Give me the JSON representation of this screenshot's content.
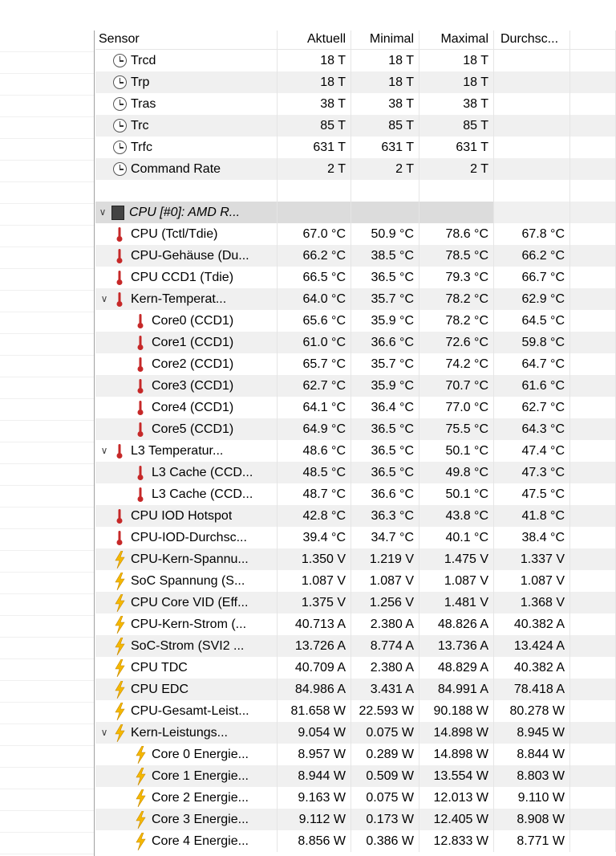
{
  "columns": {
    "sensor": "Sensor",
    "current": "Aktuell",
    "min": "Minimal",
    "max": "Maximal",
    "avg": "Durchsc..."
  },
  "rows": [
    {
      "indent": 1,
      "icon": "clock-icon",
      "label": "Trcd",
      "cur": "18 T",
      "min": "18 T",
      "max": "18 T",
      "avg": ""
    },
    {
      "indent": 1,
      "icon": "clock-icon",
      "label": "Trp",
      "cur": "18 T",
      "min": "18 T",
      "max": "18 T",
      "avg": ""
    },
    {
      "indent": 1,
      "icon": "clock-icon",
      "label": "Tras",
      "cur": "38 T",
      "min": "38 T",
      "max": "38 T",
      "avg": ""
    },
    {
      "indent": 1,
      "icon": "clock-icon",
      "label": "Trc",
      "cur": "85 T",
      "min": "85 T",
      "max": "85 T",
      "avg": ""
    },
    {
      "indent": 1,
      "icon": "clock-icon",
      "label": "Trfc",
      "cur": "631 T",
      "min": "631 T",
      "max": "631 T",
      "avg": ""
    },
    {
      "indent": 1,
      "icon": "clock-icon",
      "label": "Command Rate",
      "cur": "2 T",
      "min": "2 T",
      "max": "2 T",
      "avg": ""
    },
    {
      "indent": 0,
      "icon": "",
      "label": "",
      "cur": "",
      "min": "",
      "max": "",
      "avg": ""
    },
    {
      "indent": 0,
      "icon": "chip-icon",
      "chevron": true,
      "group": true,
      "italic": true,
      "label": "CPU [#0]: AMD R...",
      "cur": "",
      "min": "",
      "max": "",
      "avg": ""
    },
    {
      "indent": 1,
      "icon": "thermometer-icon",
      "label": "CPU (Tctl/Tdie)",
      "cur": "67.0 °C",
      "min": "50.9 °C",
      "max": "78.6 °C",
      "avg": "67.8 °C"
    },
    {
      "indent": 1,
      "icon": "thermometer-icon",
      "label": "CPU-Gehäuse (Du...",
      "cur": "66.2 °C",
      "min": "38.5 °C",
      "max": "78.5 °C",
      "avg": "66.2 °C"
    },
    {
      "indent": 1,
      "icon": "thermometer-icon",
      "label": "CPU CCD1 (Tdie)",
      "cur": "66.5 °C",
      "min": "36.5 °C",
      "max": "79.3 °C",
      "avg": "66.7 °C"
    },
    {
      "indent": 1,
      "icon": "thermometer-icon",
      "chevron": true,
      "label": "Kern-Temperat...",
      "cur": "64.0 °C",
      "min": "35.7 °C",
      "max": "78.2 °C",
      "avg": "62.9 °C"
    },
    {
      "indent": 2,
      "icon": "thermometer-icon",
      "label": "Core0 (CCD1)",
      "cur": "65.6 °C",
      "min": "35.9 °C",
      "max": "78.2 °C",
      "avg": "64.5 °C"
    },
    {
      "indent": 2,
      "icon": "thermometer-icon",
      "label": "Core1 (CCD1)",
      "cur": "61.0 °C",
      "min": "36.6 °C",
      "max": "72.6 °C",
      "avg": "59.8 °C"
    },
    {
      "indent": 2,
      "icon": "thermometer-icon",
      "label": "Core2 (CCD1)",
      "cur": "65.7 °C",
      "min": "35.7 °C",
      "max": "74.2 °C",
      "avg": "64.7 °C"
    },
    {
      "indent": 2,
      "icon": "thermometer-icon",
      "label": "Core3 (CCD1)",
      "cur": "62.7 °C",
      "min": "35.9 °C",
      "max": "70.7 °C",
      "avg": "61.6 °C"
    },
    {
      "indent": 2,
      "icon": "thermometer-icon",
      "label": "Core4 (CCD1)",
      "cur": "64.1 °C",
      "min": "36.4 °C",
      "max": "77.0 °C",
      "avg": "62.7 °C"
    },
    {
      "indent": 2,
      "icon": "thermometer-icon",
      "label": "Core5 (CCD1)",
      "cur": "64.9 °C",
      "min": "36.5 °C",
      "max": "75.5 °C",
      "avg": "64.3 °C"
    },
    {
      "indent": 1,
      "icon": "thermometer-icon",
      "chevron": true,
      "label": "L3 Temperatur...",
      "cur": "48.6 °C",
      "min": "36.5 °C",
      "max": "50.1 °C",
      "avg": "47.4 °C"
    },
    {
      "indent": 2,
      "icon": "thermometer-icon",
      "label": "L3 Cache (CCD...",
      "cur": "48.5 °C",
      "min": "36.5 °C",
      "max": "49.8 °C",
      "avg": "47.3 °C"
    },
    {
      "indent": 2,
      "icon": "thermometer-icon",
      "label": "L3 Cache (CCD...",
      "cur": "48.7 °C",
      "min": "36.6 °C",
      "max": "50.1 °C",
      "avg": "47.5 °C"
    },
    {
      "indent": 1,
      "icon": "thermometer-icon",
      "label": "CPU IOD Hotspot",
      "cur": "42.8 °C",
      "min": "36.3 °C",
      "max": "43.8 °C",
      "avg": "41.8 °C"
    },
    {
      "indent": 1,
      "icon": "thermometer-icon",
      "label": "CPU-IOD-Durchsc...",
      "cur": "39.4 °C",
      "min": "34.7 °C",
      "max": "40.1 °C",
      "avg": "38.4 °C"
    },
    {
      "indent": 1,
      "icon": "lightning-icon",
      "label": "CPU-Kern-Spannu...",
      "cur": "1.350 V",
      "min": "1.219 V",
      "max": "1.475 V",
      "avg": "1.337 V"
    },
    {
      "indent": 1,
      "icon": "lightning-icon",
      "label": "SoC Spannung (S...",
      "cur": "1.087 V",
      "min": "1.087 V",
      "max": "1.087 V",
      "avg": "1.087 V"
    },
    {
      "indent": 1,
      "icon": "lightning-icon",
      "label": "CPU Core VID (Eff...",
      "cur": "1.375 V",
      "min": "1.256 V",
      "max": "1.481 V",
      "avg": "1.368 V"
    },
    {
      "indent": 1,
      "icon": "lightning-icon",
      "label": "CPU-Kern-Strom (...",
      "cur": "40.713 A",
      "min": "2.380 A",
      "max": "48.826 A",
      "avg": "40.382 A"
    },
    {
      "indent": 1,
      "icon": "lightning-icon",
      "label": "SoC-Strom (SVI2 ...",
      "cur": "13.726 A",
      "min": "8.774 A",
      "max": "13.736 A",
      "avg": "13.424 A"
    },
    {
      "indent": 1,
      "icon": "lightning-icon",
      "label": "CPU TDC",
      "cur": "40.709 A",
      "min": "2.380 A",
      "max": "48.829 A",
      "avg": "40.382 A"
    },
    {
      "indent": 1,
      "icon": "lightning-icon",
      "label": "CPU EDC",
      "cur": "84.986 A",
      "min": "3.431 A",
      "max": "84.991 A",
      "avg": "78.418 A"
    },
    {
      "indent": 1,
      "icon": "lightning-icon",
      "label": "CPU-Gesamt-Leist...",
      "cur": "81.658 W",
      "min": "22.593 W",
      "max": "90.188 W",
      "avg": "80.278 W"
    },
    {
      "indent": 1,
      "icon": "lightning-icon",
      "chevron": true,
      "label": "Kern-Leistungs...",
      "cur": "9.054 W",
      "min": "0.075 W",
      "max": "14.898 W",
      "avg": "8.945 W"
    },
    {
      "indent": 2,
      "icon": "lightning-icon",
      "label": "Core 0 Energie...",
      "cur": "8.957 W",
      "min": "0.289 W",
      "max": "14.898 W",
      "avg": "8.844 W"
    },
    {
      "indent": 2,
      "icon": "lightning-icon",
      "label": "Core 1 Energie...",
      "cur": "8.944 W",
      "min": "0.509 W",
      "max": "13.554 W",
      "avg": "8.803 W"
    },
    {
      "indent": 2,
      "icon": "lightning-icon",
      "label": "Core 2 Energie...",
      "cur": "9.163 W",
      "min": "0.075 W",
      "max": "12.013 W",
      "avg": "9.110 W"
    },
    {
      "indent": 2,
      "icon": "lightning-icon",
      "label": "Core 3 Energie...",
      "cur": "9.112 W",
      "min": "0.173 W",
      "max": "12.405 W",
      "avg": "8.908 W"
    },
    {
      "indent": 2,
      "icon": "lightning-icon",
      "label": "Core 4 Energie...",
      "cur": "8.856 W",
      "min": "0.386 W",
      "max": "12.833 W",
      "avg": "8.771 W"
    }
  ],
  "colors": {
    "thermometer": "#c62828",
    "lightning": "#f5b800",
    "group_bg": "#dcdcdc",
    "alt_row": "#f0f0f0"
  }
}
